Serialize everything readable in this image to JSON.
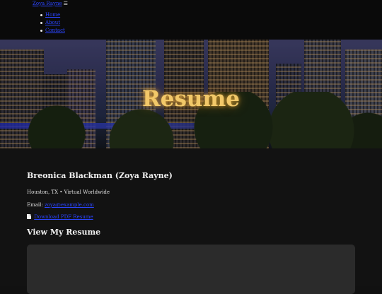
{
  "nav": {
    "menu_label": "Zoya Rayne",
    "menu_icon": "☰",
    "items": [
      {
        "label": "Home"
      },
      {
        "label": "About"
      },
      {
        "label": "Contact"
      }
    ]
  },
  "hero": {
    "title": "Resume"
  },
  "profile": {
    "name": "Breonica Blackman (Zoya Rayne)",
    "location": "Houston, TX • Virtual Worldwide",
    "email_label": "Email:",
    "email": "zoya@example.com",
    "download_label": "Download PDF Resume"
  },
  "viewer": {
    "heading": "View My Resume"
  },
  "colors": {
    "accent_title": "#f2c869",
    "link": "#2b45ff",
    "background": "#121212"
  }
}
